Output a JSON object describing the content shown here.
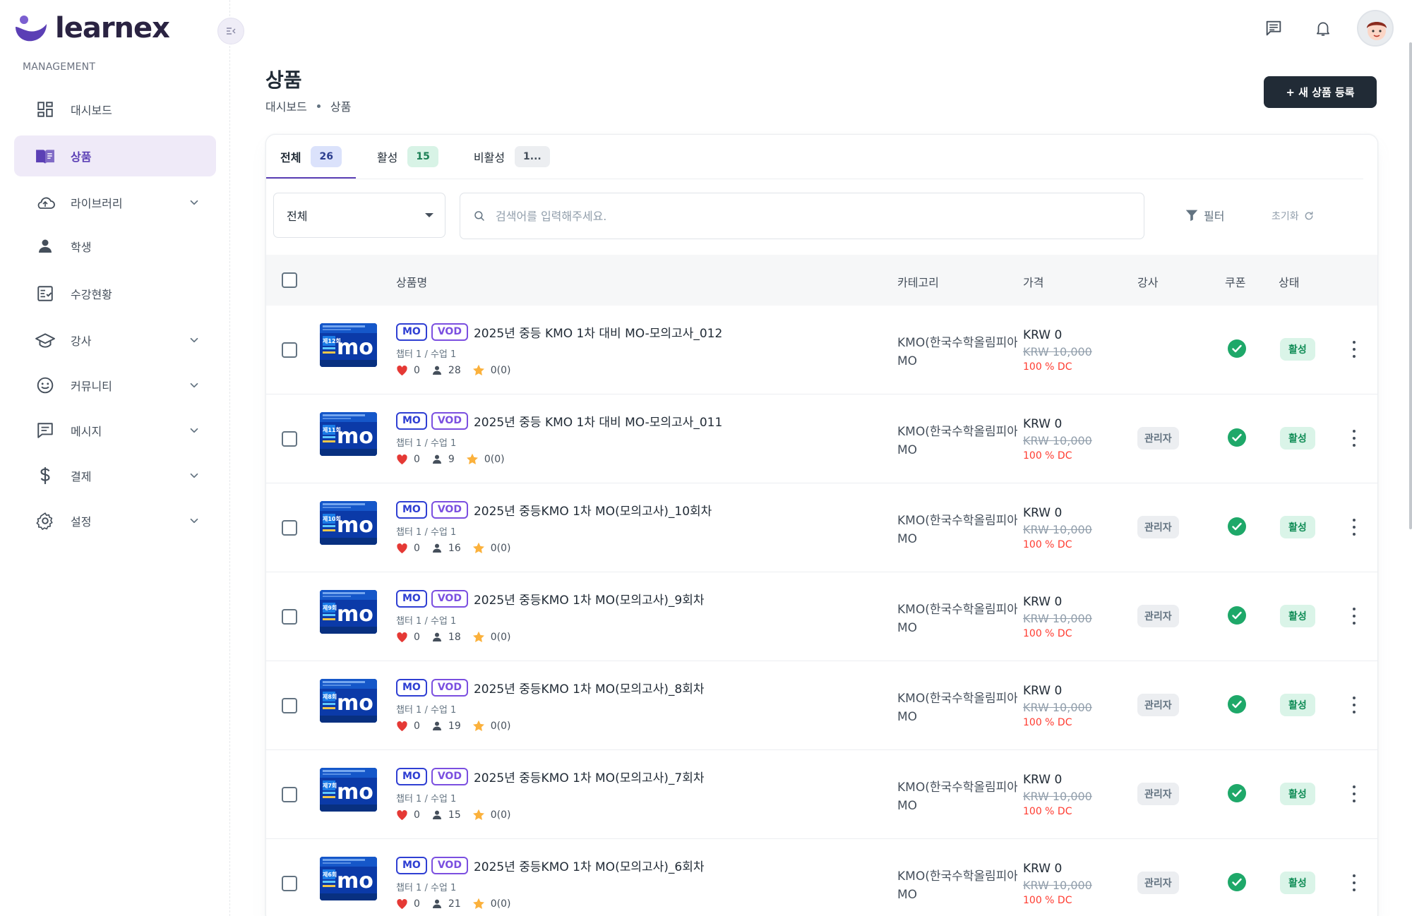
{
  "app": {
    "logo_text": "learnex"
  },
  "sidebar": {
    "section_label": "MANAGEMENT",
    "items": [
      {
        "label": "대시보드",
        "icon": "dashboard-icon",
        "active": false,
        "chevron": false
      },
      {
        "label": "상품",
        "icon": "book-icon",
        "active": true,
        "chevron": false
      },
      {
        "label": "라이브러리",
        "icon": "cloud-icon",
        "active": false,
        "chevron": true
      },
      {
        "label": "학생",
        "icon": "person-icon",
        "active": false,
        "chevron": false
      },
      {
        "label": "수강현황",
        "icon": "checklist-icon",
        "active": false,
        "chevron": false
      },
      {
        "label": "강사",
        "icon": "graduation-cap-icon",
        "active": false,
        "chevron": true
      },
      {
        "label": "커뮤니티",
        "icon": "smiley-icon",
        "active": false,
        "chevron": true
      },
      {
        "label": "메시지",
        "icon": "message-icon",
        "active": false,
        "chevron": true
      },
      {
        "label": "결제",
        "icon": "dollar-icon",
        "active": false,
        "chevron": true
      },
      {
        "label": "설정",
        "icon": "gear-icon",
        "active": false,
        "chevron": true
      }
    ]
  },
  "header": {
    "title": "상품",
    "breadcrumb": [
      "대시보드",
      "상품"
    ],
    "new_button": "+ 새 상품 등록"
  },
  "tabs": [
    {
      "label": "전체",
      "count": "26",
      "active": true
    },
    {
      "label": "활성",
      "count": "15",
      "active": false
    },
    {
      "label": "비활성",
      "count": "1...",
      "active": false
    }
  ],
  "filters": {
    "select_value": "전체",
    "search_placeholder": "검색어를 입력해주세요.",
    "filter_label": "필터",
    "reset_label": "초기화"
  },
  "table": {
    "headers": {
      "name": "상품명",
      "category": "카테고리",
      "price": "가격",
      "teacher": "강사",
      "coupon": "쿠폰",
      "status": "상태"
    },
    "rows": [
      {
        "thumb_num": "제12회",
        "badge1": "MO",
        "badge2": "VOD",
        "title": "2025년 중등 KMO 1차 대비 MO-모의고사_012",
        "sub": "챕터 1 / 수업 1",
        "likes": "0",
        "students": "28",
        "rating": "0(0)",
        "cat1": "KMO(한국수학올림피아드)",
        "cat2": "MO",
        "price": "KRW 0",
        "old_price": "KRW 10,000",
        "dc": "100 % DC",
        "teacher": "",
        "status": "활성"
      },
      {
        "thumb_num": "제11회",
        "badge1": "MO",
        "badge2": "VOD",
        "title": "2025년 중등 KMO 1차 대비 MO-모의고사_011",
        "sub": "챕터 1 / 수업 1",
        "likes": "0",
        "students": "9",
        "rating": "0(0)",
        "cat1": "KMO(한국수학올림피아드)",
        "cat2": "MO",
        "price": "KRW 0",
        "old_price": "KRW 10,000",
        "dc": "100 % DC",
        "teacher": "관리자",
        "status": "활성"
      },
      {
        "thumb_num": "제10회",
        "badge1": "MO",
        "badge2": "VOD",
        "title": "2025년 중등KMO 1차 MO(모의고사)_10회차",
        "sub": "챕터 1 / 수업 1",
        "likes": "0",
        "students": "16",
        "rating": "0(0)",
        "cat1": "KMO(한국수학올림피아드)",
        "cat2": "MO",
        "price": "KRW 0",
        "old_price": "KRW 10,000",
        "dc": "100 % DC",
        "teacher": "관리자",
        "status": "활성"
      },
      {
        "thumb_num": "제9회",
        "badge1": "MO",
        "badge2": "VOD",
        "title": "2025년 중등KMO 1차 MO(모의고사)_9회차",
        "sub": "챕터 1 / 수업 1",
        "likes": "0",
        "students": "18",
        "rating": "0(0)",
        "cat1": "KMO(한국수학올림피아드)",
        "cat2": "MO",
        "price": "KRW 0",
        "old_price": "KRW 10,000",
        "dc": "100 % DC",
        "teacher": "관리자",
        "status": "활성"
      },
      {
        "thumb_num": "제8회",
        "badge1": "MO",
        "badge2": "VOD",
        "title": "2025년 중등KMO 1차 MO(모의고사)_8회차",
        "sub": "챕터 1 / 수업 1",
        "likes": "0",
        "students": "19",
        "rating": "0(0)",
        "cat1": "KMO(한국수학올림피아드)",
        "cat2": "MO",
        "price": "KRW 0",
        "old_price": "KRW 10,000",
        "dc": "100 % DC",
        "teacher": "관리자",
        "status": "활성"
      },
      {
        "thumb_num": "제7회",
        "badge1": "MO",
        "badge2": "VOD",
        "title": "2025년 중등KMO 1차 MO(모의고사)_7회차",
        "sub": "챕터 1 / 수업 1",
        "likes": "0",
        "students": "15",
        "rating": "0(0)",
        "cat1": "KMO(한국수학올림피아드)",
        "cat2": "MO",
        "price": "KRW 0",
        "old_price": "KRW 10,000",
        "dc": "100 % DC",
        "teacher": "관리자",
        "status": "활성"
      },
      {
        "thumb_num": "제6회",
        "badge1": "MO",
        "badge2": "VOD",
        "title": "2025년 중등KMO 1차 MO(모의고사)_6회차",
        "sub": "챕터 1 / 수업 1",
        "likes": "0",
        "students": "21",
        "rating": "0(0)",
        "cat1": "KMO(한국수학올림피아드)",
        "cat2": "MO",
        "price": "KRW 0",
        "old_price": "KRW 10,000",
        "dc": "100 % DC",
        "teacher": "관리자",
        "status": "활성"
      }
    ]
  },
  "colors": {
    "accent": "#5b3fb5",
    "active_green": "#1ea869",
    "discount_red": "#ff3b30",
    "primary_dark": "#212b36"
  }
}
